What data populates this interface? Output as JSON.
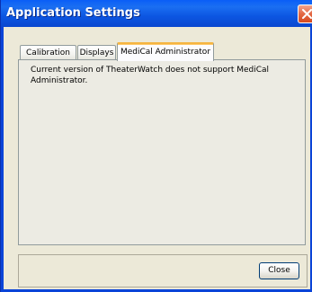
{
  "window": {
    "title": "Application Settings",
    "close_icon": "close-icon"
  },
  "tabs": [
    {
      "label": "Calibration",
      "active": false
    },
    {
      "label": "Displays",
      "active": false
    },
    {
      "label": "MediCal Administrator",
      "active": true
    }
  ],
  "panel": {
    "message": "Current version of TheaterWatch does not support MediCal Administrator."
  },
  "footer": {
    "close_label": "Close"
  },
  "colors": {
    "titlebar": "#0a5ef7",
    "active_tab_accent": "#f5b541",
    "client_bg": "#ece9d8",
    "close_icon_bg": "#e36844"
  }
}
